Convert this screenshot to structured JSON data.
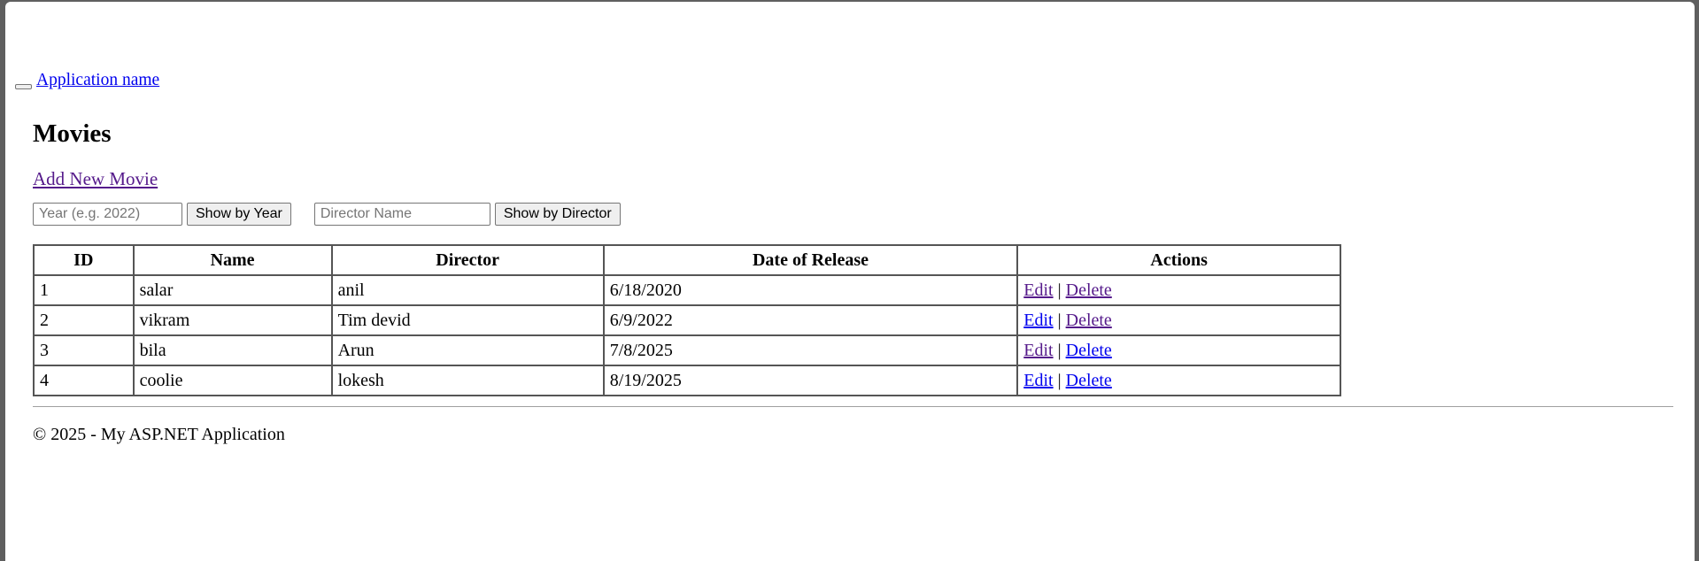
{
  "navbar": {
    "brand": "Application name"
  },
  "main": {
    "title": "Movies",
    "add_link": "Add New Movie",
    "filters": {
      "year_placeholder": "Year (e.g. 2022)",
      "year_button": "Show by Year",
      "director_placeholder": "Director Name",
      "director_button": "Show by Director"
    },
    "table": {
      "headers": [
        "ID",
        "Name",
        "Director",
        "Date of Release",
        "Actions"
      ],
      "rows": [
        {
          "id": "1",
          "name": "salar",
          "director": "anil",
          "date": "6/18/2020",
          "edit": "Edit",
          "sep": "|",
          "delete": "Delete"
        },
        {
          "id": "2",
          "name": "vikram",
          "director": "Tim devid",
          "date": "6/9/2022",
          "edit": "Edit",
          "sep": "|",
          "delete": "Delete"
        },
        {
          "id": "3",
          "name": "bila",
          "director": "Arun",
          "date": "7/8/2025",
          "edit": "Edit",
          "sep": "|",
          "delete": "Delete"
        },
        {
          "id": "4",
          "name": "coolie",
          "director": "lokesh",
          "date": "8/19/2025",
          "edit": "Edit",
          "sep": "|",
          "delete": "Delete"
        }
      ]
    }
  },
  "footer": {
    "text": "© 2025 - My ASP.NET Application"
  }
}
